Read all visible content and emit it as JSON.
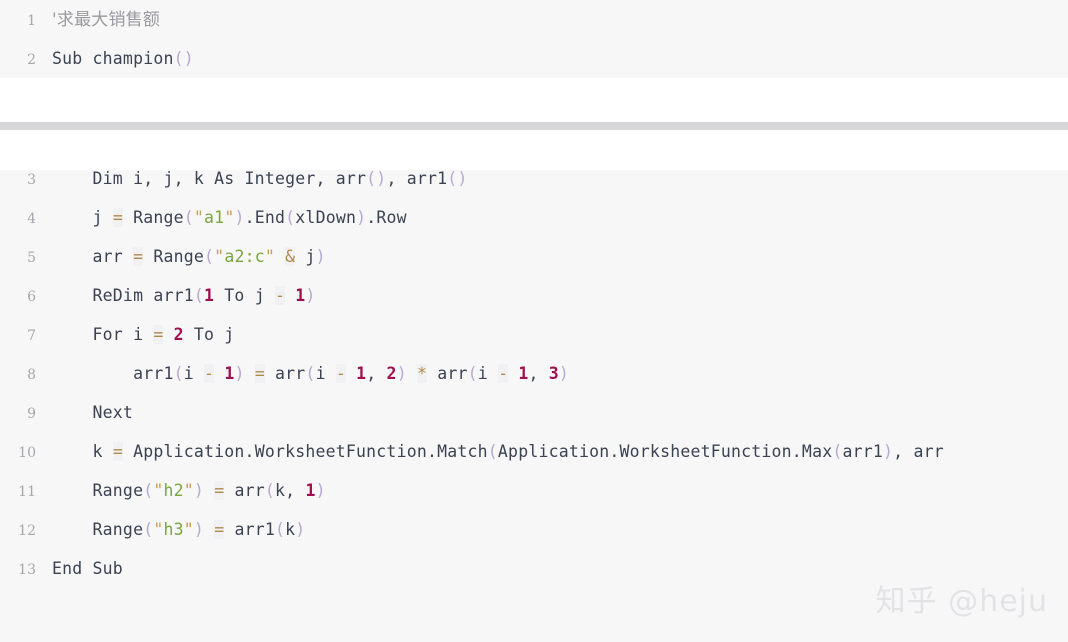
{
  "watermark": {
    "text": "知乎 @heju"
  },
  "blocks": {
    "top": {
      "lines": [
        {
          "num": "1",
          "tokens": [
            {
              "t": "comment",
              "v": "'求最大销售额"
            }
          ]
        },
        {
          "num": "2",
          "tokens": [
            {
              "t": "plain",
              "v": "Sub champion"
            },
            {
              "t": "punct",
              "v": "()"
            }
          ]
        }
      ]
    },
    "main": {
      "clipped_line": {
        "num": "",
        "tokens": [
          {
            "t": "plain",
            "v": "Sub champion"
          },
          {
            "t": "punct",
            "v": "()"
          }
        ]
      },
      "lines": [
        {
          "num": "3",
          "tokens": [
            {
              "t": "plain",
              "v": "    Dim i, j, k As Integer, arr"
            },
            {
              "t": "punct",
              "v": "()"
            },
            {
              "t": "plain",
              "v": ", arr1"
            },
            {
              "t": "punct",
              "v": "()"
            }
          ]
        },
        {
          "num": "4",
          "tokens": [
            {
              "t": "plain",
              "v": "    j "
            },
            {
              "t": "op",
              "v": "="
            },
            {
              "t": "plain",
              "v": " Range"
            },
            {
              "t": "punct",
              "v": "("
            },
            {
              "t": "quote",
              "v": "\""
            },
            {
              "t": "string",
              "v": "a1"
            },
            {
              "t": "quote",
              "v": "\""
            },
            {
              "t": "punct",
              "v": ")"
            },
            {
              "t": "plain",
              "v": ".End"
            },
            {
              "t": "punct",
              "v": "("
            },
            {
              "t": "plain",
              "v": "xlDown"
            },
            {
              "t": "punct",
              "v": ")"
            },
            {
              "t": "plain",
              "v": ".Row"
            }
          ]
        },
        {
          "num": "5",
          "tokens": [
            {
              "t": "plain",
              "v": "    arr "
            },
            {
              "t": "op",
              "v": "="
            },
            {
              "t": "plain",
              "v": " Range"
            },
            {
              "t": "punct",
              "v": "("
            },
            {
              "t": "quote",
              "v": "\""
            },
            {
              "t": "string",
              "v": "a2:c"
            },
            {
              "t": "quote",
              "v": "\""
            },
            {
              "t": "plain",
              "v": " "
            },
            {
              "t": "op",
              "v": "&"
            },
            {
              "t": "plain",
              "v": " j"
            },
            {
              "t": "punct",
              "v": ")"
            }
          ]
        },
        {
          "num": "6",
          "tokens": [
            {
              "t": "plain",
              "v": "    ReDim arr1"
            },
            {
              "t": "punct",
              "v": "("
            },
            {
              "t": "num",
              "v": "1"
            },
            {
              "t": "plain",
              "v": " To j "
            },
            {
              "t": "op",
              "v": "-"
            },
            {
              "t": "plain",
              "v": " "
            },
            {
              "t": "num",
              "v": "1"
            },
            {
              "t": "punct",
              "v": ")"
            }
          ]
        },
        {
          "num": "7",
          "tokens": [
            {
              "t": "plain",
              "v": "    For i "
            },
            {
              "t": "op",
              "v": "="
            },
            {
              "t": "plain",
              "v": " "
            },
            {
              "t": "num",
              "v": "2"
            },
            {
              "t": "plain",
              "v": " To j"
            }
          ]
        },
        {
          "num": "8",
          "tokens": [
            {
              "t": "plain",
              "v": "        arr1"
            },
            {
              "t": "punct",
              "v": "("
            },
            {
              "t": "plain",
              "v": "i "
            },
            {
              "t": "op",
              "v": "-"
            },
            {
              "t": "plain",
              "v": " "
            },
            {
              "t": "num",
              "v": "1"
            },
            {
              "t": "punct",
              "v": ")"
            },
            {
              "t": "plain",
              "v": " "
            },
            {
              "t": "op",
              "v": "="
            },
            {
              "t": "plain",
              "v": " arr"
            },
            {
              "t": "punct",
              "v": "("
            },
            {
              "t": "plain",
              "v": "i "
            },
            {
              "t": "op",
              "v": "-"
            },
            {
              "t": "plain",
              "v": " "
            },
            {
              "t": "num",
              "v": "1"
            },
            {
              "t": "plain",
              "v": ", "
            },
            {
              "t": "num",
              "v": "2"
            },
            {
              "t": "punct",
              "v": ")"
            },
            {
              "t": "plain",
              "v": " "
            },
            {
              "t": "op",
              "v": "*"
            },
            {
              "t": "plain",
              "v": " arr"
            },
            {
              "t": "punct",
              "v": "("
            },
            {
              "t": "plain",
              "v": "i "
            },
            {
              "t": "op",
              "v": "-"
            },
            {
              "t": "plain",
              "v": " "
            },
            {
              "t": "num",
              "v": "1"
            },
            {
              "t": "plain",
              "v": ", "
            },
            {
              "t": "num",
              "v": "3"
            },
            {
              "t": "punct",
              "v": ")"
            }
          ]
        },
        {
          "num": "9",
          "tokens": [
            {
              "t": "plain",
              "v": "    Next"
            }
          ]
        },
        {
          "num": "10",
          "tokens": [
            {
              "t": "plain",
              "v": "    k "
            },
            {
              "t": "op",
              "v": "="
            },
            {
              "t": "plain",
              "v": " Application.WorksheetFunction.Match"
            },
            {
              "t": "punct",
              "v": "("
            },
            {
              "t": "plain",
              "v": "Application.WorksheetFunction.Max"
            },
            {
              "t": "punct",
              "v": "("
            },
            {
              "t": "plain",
              "v": "arr1"
            },
            {
              "t": "punct",
              "v": ")"
            },
            {
              "t": "plain",
              "v": ", arr"
            }
          ]
        },
        {
          "num": "11",
          "tokens": [
            {
              "t": "plain",
              "v": "    Range"
            },
            {
              "t": "punct",
              "v": "("
            },
            {
              "t": "quote",
              "v": "\""
            },
            {
              "t": "string",
              "v": "h2"
            },
            {
              "t": "quote",
              "v": "\""
            },
            {
              "t": "punct",
              "v": ")"
            },
            {
              "t": "plain",
              "v": " "
            },
            {
              "t": "op",
              "v": "="
            },
            {
              "t": "plain",
              "v": " arr"
            },
            {
              "t": "punct",
              "v": "("
            },
            {
              "t": "plain",
              "v": "k, "
            },
            {
              "t": "num",
              "v": "1"
            },
            {
              "t": "punct",
              "v": ")"
            }
          ]
        },
        {
          "num": "12",
          "tokens": [
            {
              "t": "plain",
              "v": "    Range"
            },
            {
              "t": "punct",
              "v": "("
            },
            {
              "t": "quote",
              "v": "\""
            },
            {
              "t": "string",
              "v": "h3"
            },
            {
              "t": "quote",
              "v": "\""
            },
            {
              "t": "punct",
              "v": ")"
            },
            {
              "t": "plain",
              "v": " "
            },
            {
              "t": "op",
              "v": "="
            },
            {
              "t": "plain",
              "v": " arr1"
            },
            {
              "t": "punct",
              "v": "("
            },
            {
              "t": "plain",
              "v": "k"
            },
            {
              "t": "punct",
              "v": ")"
            }
          ]
        },
        {
          "num": "13",
          "tokens": [
            {
              "t": "plain",
              "v": "End Sub"
            }
          ]
        }
      ]
    }
  }
}
